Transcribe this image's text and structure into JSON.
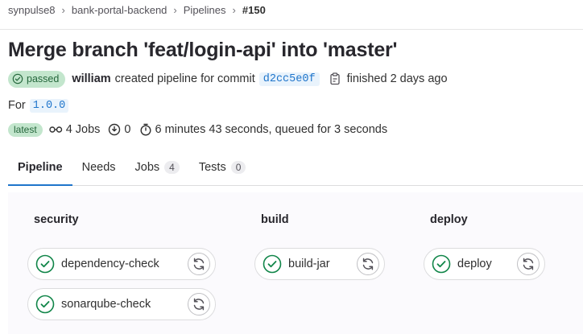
{
  "breadcrumb": {
    "items": [
      "synpulse8",
      "bank-portal-backend",
      "Pipelines"
    ],
    "separator": "›",
    "current": "#150"
  },
  "pipeline": {
    "title": "Merge branch 'feat/login-api' into 'master'",
    "status": "passed",
    "user": "william",
    "created_text": "created pipeline for commit",
    "commit_sha": "d2cc5e0f",
    "finished_text": "finished 2 days ago",
    "for_label": "For",
    "ref": "1.0.0",
    "latest_badge": "latest",
    "jobs_text": "4 Jobs",
    "failed_count": "0",
    "duration_text": "6 minutes 43 seconds, queued for 3 seconds"
  },
  "tabs": [
    {
      "label": "Pipeline",
      "count": null,
      "active": true
    },
    {
      "label": "Needs",
      "count": null,
      "active": false
    },
    {
      "label": "Jobs",
      "count": "4",
      "active": false
    },
    {
      "label": "Tests",
      "count": "0",
      "active": false
    }
  ],
  "stages": [
    {
      "name": "security",
      "jobs": [
        "dependency-check",
        "sonarqube-check"
      ]
    },
    {
      "name": "build",
      "jobs": [
        "build-jar"
      ]
    },
    {
      "name": "deploy",
      "jobs": [
        "deploy"
      ]
    }
  ],
  "colors": {
    "success": "#108548",
    "link": "#1f75cb",
    "badge_bg": "#c3e6cd"
  },
  "icons": {
    "status": "check-circle-icon",
    "retry": "retry-icon",
    "copy": "clipboard-icon",
    "jobs": "pipeline-icon",
    "failed": "failed-jobs-icon",
    "duration": "timer-icon"
  }
}
